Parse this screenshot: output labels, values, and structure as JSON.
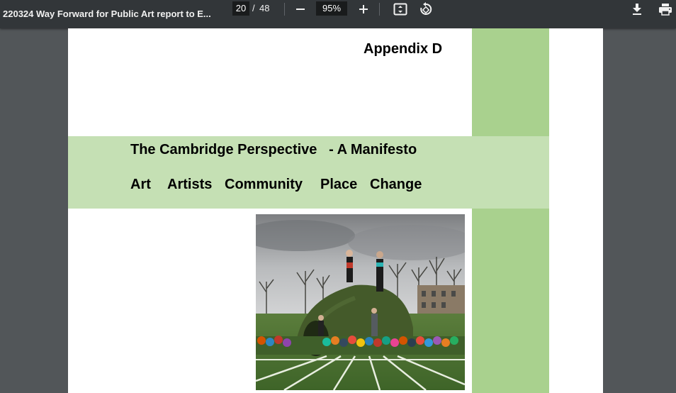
{
  "toolbar": {
    "doc_title": "220324 Way Forward for Public Art report to E...",
    "current_page": "20",
    "page_separator": "/",
    "total_pages": "48",
    "zoom": "95%"
  },
  "page": {
    "appendix_heading": "Appendix D",
    "manifesto_title": "The Cambridge Perspective   - A Manifesto",
    "keywords": [
      "Art",
      "Artists",
      "Community",
      "Place",
      "Change"
    ]
  },
  "colors": {
    "toolbar_bg": "#323639",
    "viewer_bg": "#525659",
    "green_column": "#a9d18e",
    "green_band": "#c5e0b4"
  },
  "icons": {
    "zoom_out": "minus-icon",
    "zoom_in": "plus-icon",
    "fit_page": "fit-page-icon",
    "rotate": "rotate-icon",
    "download": "download-icon",
    "print": "print-icon"
  }
}
